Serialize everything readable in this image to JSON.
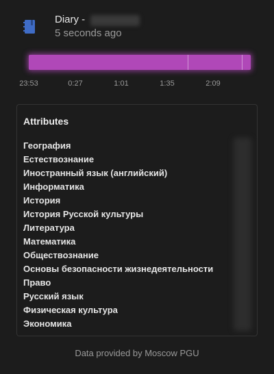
{
  "header": {
    "title": "Diary -",
    "subtitle": "5 seconds ago",
    "icon": "notebook-icon"
  },
  "timeline": {
    "color": "#b048b8",
    "tick_labels": [
      "23:53",
      "0:27",
      "1:01",
      "1:35",
      "2:09"
    ]
  },
  "attributes": {
    "title": "Attributes",
    "items": [
      "География",
      "Естествознание",
      "Иностранный язык (английский)",
      "Информатика",
      "История",
      "История Русской культуры",
      "Литература",
      "Математика",
      "Обществознание",
      "Основы безопасности жизнедеятельности",
      "Право",
      "Русский язык",
      "Физическая культура",
      "Экономика"
    ]
  },
  "footer": {
    "text": "Data provided by Moscow PGU"
  }
}
